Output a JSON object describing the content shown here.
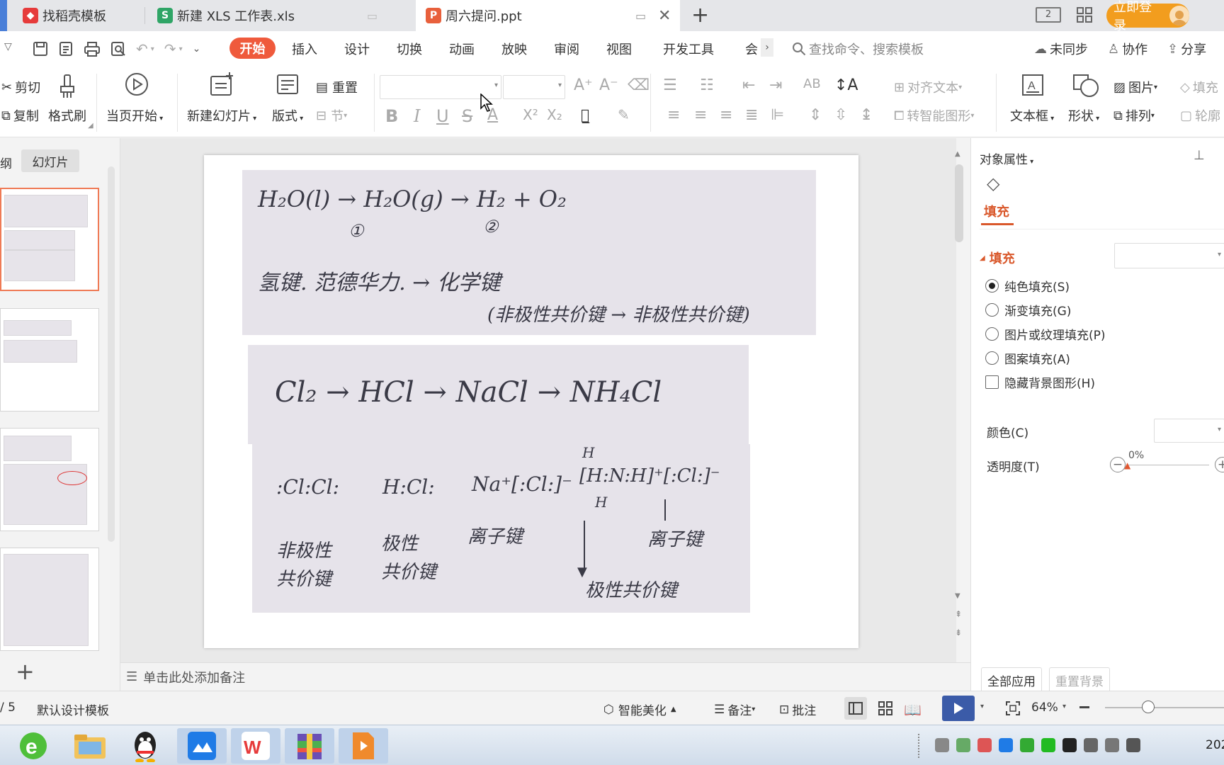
{
  "tabs": [
    {
      "label": "找稻壳模板",
      "icon": "docer-icon"
    },
    {
      "label": "新建 XLS 工作表.xls",
      "icon": "spreadsheet-icon"
    },
    {
      "label": "周六提问.ppt",
      "icon": "presentation-icon"
    }
  ],
  "header": {
    "login_label": "立即登录"
  },
  "menu": {
    "items": [
      "开始",
      "插入",
      "设计",
      "切换",
      "动画",
      "放映",
      "审阅",
      "视图",
      "开发工具",
      "会"
    ],
    "search_placeholder": "查找命令、搜索模板",
    "sync": "未同步",
    "collab": "协作",
    "share": "分享"
  },
  "ribbon": {
    "cut": "剪切",
    "copy": "复制",
    "format_painter": "格式刷",
    "start_from_current": "当页开始",
    "new_slide": "新建幻灯片",
    "layout": "版式",
    "reset": "重置",
    "section": "节",
    "align_text": "对齐文本",
    "smart_graphic": "转智能图形",
    "textbox": "文本框",
    "shape": "形状",
    "picture": "图片",
    "arrange": "排列",
    "fill": "填充",
    "outline": "轮廓"
  },
  "left_pane": {
    "tab_outline": "纲",
    "tab_slides": "幻灯片"
  },
  "slide_content": {
    "line1": "H₂O(l) → H₂O(g) → H₂ + O₂",
    "mark1": "①",
    "mark2": "②",
    "line2": "氢键. 范德华力. → 化学键",
    "line3": "(非极性共价键 → 非极性共价键)",
    "chain": "Cl₂ → HCl → NaCl → NH₄Cl",
    "e1": ":Cl:Cl:",
    "e2": "H:Cl:",
    "e3": "Na⁺[:Cl:]⁻",
    "e4": "[H:N:H]⁺[:Cl:]⁻",
    "h_top": "H",
    "h_bottom": "H",
    "l1a": "非极性",
    "l1b": "共价键",
    "l2a": "极性",
    "l2b": "共价键",
    "l3": "离子键",
    "l4": "离子键",
    "l5": "极性共价键"
  },
  "notes_placeholder": "单击此处添加备注",
  "right_pane": {
    "title": "对象属性",
    "tab_fill": "填充",
    "section_fill": "填充",
    "options": [
      "纯色填充(S)",
      "渐变填充(G)",
      "图片或纹理填充(P)",
      "图案填充(A)"
    ],
    "hide_bg": "隐藏背景图形(H)",
    "color_label": "颜色(C)",
    "transparency_label": "透明度(T)",
    "transparency_value": "0%",
    "apply_all": "全部应用",
    "reset_bg": "重置背景"
  },
  "status": {
    "page": "/ 5",
    "theme": "默认设计模板",
    "beautify": "智能美化",
    "notes": "备注",
    "comments": "批注",
    "zoom": "64%"
  },
  "taskbar": {
    "year": "202"
  },
  "colors": {
    "accent": "#ef5a3c",
    "login": "#f29d1e",
    "fill_tab": "#d9582b",
    "selection": "#ef7a55"
  }
}
